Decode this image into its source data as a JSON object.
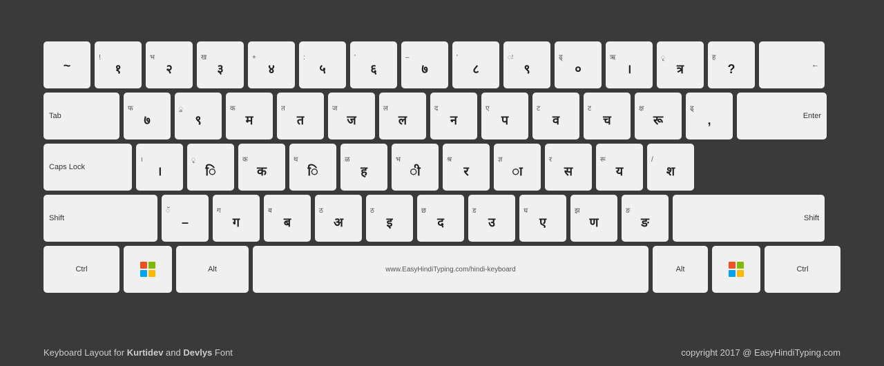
{
  "keyboard": {
    "rows": [
      [
        {
          "id": "backtick",
          "top": "",
          "main": "~",
          "label": ""
        },
        {
          "id": "1",
          "top": "!",
          "main": "१",
          "label": ""
        },
        {
          "id": "2",
          "top": "भ",
          "main": "२",
          "label": ""
        },
        {
          "id": "3",
          "top": "ख",
          "main": "३",
          "label": ""
        },
        {
          "id": "4",
          "top": "+",
          "main": "४",
          "label": ""
        },
        {
          "id": "5",
          "top": ":",
          "main": "५",
          "label": ""
        },
        {
          "id": "6",
          "top": "'",
          "main": "६",
          "label": ""
        },
        {
          "id": "7",
          "top": "–",
          "main": "७",
          "label": ""
        },
        {
          "id": "8",
          "top": "'",
          "main": "८",
          "label": ""
        },
        {
          "id": "9",
          "top": "ः",
          "main": "९",
          "label": ""
        },
        {
          "id": "0",
          "top": "ढ्",
          "main": "०",
          "label": ""
        },
        {
          "id": "minus",
          "top": "ऋ",
          "main": "।",
          "label": ""
        },
        {
          "id": "equals",
          "top": "ृ",
          "main": "त्र",
          "label": ""
        },
        {
          "id": "bslash",
          "top": "ह",
          "main": "?",
          "label": ""
        },
        {
          "id": "backspace",
          "top": "",
          "main": "←",
          "label": "",
          "wide": "backspace"
        }
      ],
      [
        {
          "id": "tab",
          "top": "",
          "main": "",
          "label": "Tab",
          "wide": "tab"
        },
        {
          "id": "q",
          "top": "फ",
          "main": "७",
          "label": ""
        },
        {
          "id": "w",
          "top": "ु",
          "main": "९",
          "label": ""
        },
        {
          "id": "e",
          "top": "क",
          "main": "म",
          "label": ""
        },
        {
          "id": "r",
          "top": "त",
          "main": "त",
          "label": ""
        },
        {
          "id": "t",
          "top": "ज",
          "main": "ज",
          "label": ""
        },
        {
          "id": "y",
          "top": "ल",
          "main": "ल",
          "label": ""
        },
        {
          "id": "u",
          "top": "द",
          "main": "न",
          "label": ""
        },
        {
          "id": "i",
          "top": "ए",
          "main": "प",
          "label": ""
        },
        {
          "id": "o",
          "top": "ट",
          "main": "व",
          "label": ""
        },
        {
          "id": "p",
          "top": "ट",
          "main": "च",
          "label": ""
        },
        {
          "id": "lbracket",
          "top": "क्ष",
          "main": "रू",
          "label": ""
        },
        {
          "id": "rbracket",
          "top": "ढ्",
          "main": ",",
          "label": ""
        },
        {
          "id": "enter",
          "top": "",
          "main": "",
          "label": "",
          "wide": "enter"
        }
      ],
      [
        {
          "id": "capslock",
          "top": "",
          "main": "",
          "label": "Caps Lock",
          "wide": "capslock"
        },
        {
          "id": "a",
          "top": "।",
          "main": "।",
          "label": ""
        },
        {
          "id": "s",
          "top": "ृ",
          "main": "ि",
          "label": ""
        },
        {
          "id": "d",
          "top": "क",
          "main": "क",
          "label": ""
        },
        {
          "id": "f",
          "top": "थ",
          "main": "ि",
          "label": ""
        },
        {
          "id": "g",
          "top": "ळ",
          "main": "ह",
          "label": ""
        },
        {
          "id": "h",
          "top": "भ",
          "main": "ी",
          "label": ""
        },
        {
          "id": "j",
          "top": "श्र",
          "main": "र",
          "label": ""
        },
        {
          "id": "k",
          "top": "ज्ञ",
          "main": "ा",
          "label": ""
        },
        {
          "id": "l",
          "top": "र",
          "main": "स",
          "label": ""
        },
        {
          "id": "semi",
          "top": "रू",
          "main": "य",
          "label": ""
        },
        {
          "id": "quote",
          "top": "/",
          "main": "श",
          "label": ""
        }
      ],
      [
        {
          "id": "shift-l",
          "top": "",
          "main": "",
          "label": "Shift",
          "wide": "shift-l"
        },
        {
          "id": "z",
          "top": "ॅ",
          "main": "–",
          "label": ""
        },
        {
          "id": "x",
          "top": "ग",
          "main": "ग",
          "label": ""
        },
        {
          "id": "c",
          "top": "ब",
          "main": "ब",
          "label": ""
        },
        {
          "id": "v",
          "top": "ठ",
          "main": "अ",
          "label": ""
        },
        {
          "id": "b",
          "top": "ठ",
          "main": "इ",
          "label": ""
        },
        {
          "id": "n",
          "top": "छ",
          "main": "द",
          "label": ""
        },
        {
          "id": "m",
          "top": "ड",
          "main": "उ",
          "label": ""
        },
        {
          "id": "comma",
          "top": "ध",
          "main": "ए",
          "label": ""
        },
        {
          "id": "period",
          "top": "झ",
          "main": "ण",
          "label": ""
        },
        {
          "id": "fslash",
          "top": "ङ",
          "main": "ङ",
          "label": ""
        },
        {
          "id": "shift-r",
          "top": "",
          "main": "",
          "label": "Shift",
          "wide": "shift-r"
        }
      ],
      [
        {
          "id": "ctrl-l",
          "top": "",
          "main": "",
          "label": "Ctrl",
          "wide": "ctrl"
        },
        {
          "id": "win-l",
          "top": "",
          "main": "win",
          "label": "",
          "wide": "win"
        },
        {
          "id": "alt-l",
          "top": "",
          "main": "",
          "label": "Alt",
          "wide": "alt"
        },
        {
          "id": "space",
          "top": "",
          "main": "www.EasyHindiTyping.com/hindi-keyboard",
          "label": "",
          "wide": "space"
        },
        {
          "id": "alt-r",
          "top": "",
          "main": "",
          "label": "Alt",
          "wide": "alt-r"
        },
        {
          "id": "win-r",
          "top": "",
          "main": "win",
          "label": "",
          "wide": "win"
        },
        {
          "id": "ctrl-r",
          "top": "",
          "main": "",
          "label": "Ctrl",
          "wide": "ctrl"
        }
      ]
    ],
    "footer": {
      "left_plain": "Keyboard Layout for ",
      "left_bold1": "Kurtidev",
      "left_mid": " and ",
      "left_bold2": "Devlys",
      "left_end": " Font",
      "right": "copyright 2017 @ EasyHindiTyping.com"
    }
  }
}
